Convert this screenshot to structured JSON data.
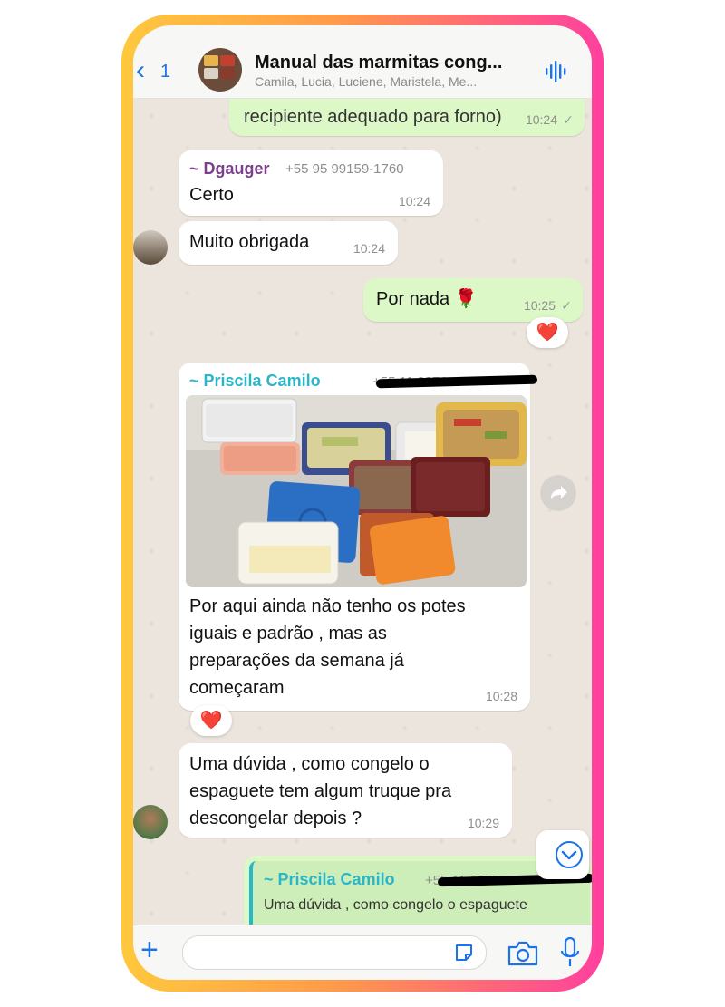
{
  "header": {
    "back_count": "1",
    "title": "Manual das marmitas cong...",
    "subtitle": "Camila, Lucia, Luciene, Maristela, Me..."
  },
  "messages": {
    "m0": {
      "text": "recipiente adequado para forno)",
      "time": "10:24",
      "status": "✓"
    },
    "m1": {
      "sender": "~ Dgauger",
      "phone": "+55 95 99159-1760",
      "text": "Certo",
      "time": "10:24"
    },
    "m2": {
      "text": "Muito obrigada",
      "time": "10:24"
    },
    "m3": {
      "text": "Por nada 🌹",
      "time": "10:25",
      "status": "✓",
      "reaction": "❤️"
    },
    "m4": {
      "sender": "~ Priscila Camilo",
      "phone": "+55 11 9876",
      "lines": [
        "Por aqui ainda não tenho os potes",
        "iguais e padrão , mas as",
        "preparações da semana já",
        "começaram"
      ],
      "time": "10:28",
      "reaction": "❤️"
    },
    "m5": {
      "lines": [
        "Uma dúvida , como congelo o",
        "espaguete tem algum truque pra",
        "descongelar depois ?"
      ],
      "time": "10:29"
    },
    "m6": {
      "quote_sender": "~ Priscila Camilo",
      "quote_phone": "+55 11 9876",
      "quote_text": "Uma dúvida , como congelo o espaguete"
    }
  },
  "colors": {
    "frame_start": "#ffc83d",
    "frame_end": "#ff3f9e",
    "accent": "#1a73e8",
    "sender_dgauger": "#7b3f8c",
    "sender_priscila": "#29b6c8",
    "outgoing_bubble": "#dcf8c6"
  },
  "icons": {
    "back": "chevron-left-icon",
    "audio": "audio-wave-icon",
    "forward": "forward-icon",
    "scroll": "chevron-down-circle-icon",
    "attach": "plus-icon",
    "sticker": "sticker-icon",
    "camera": "camera-icon",
    "mic": "microphone-icon"
  }
}
